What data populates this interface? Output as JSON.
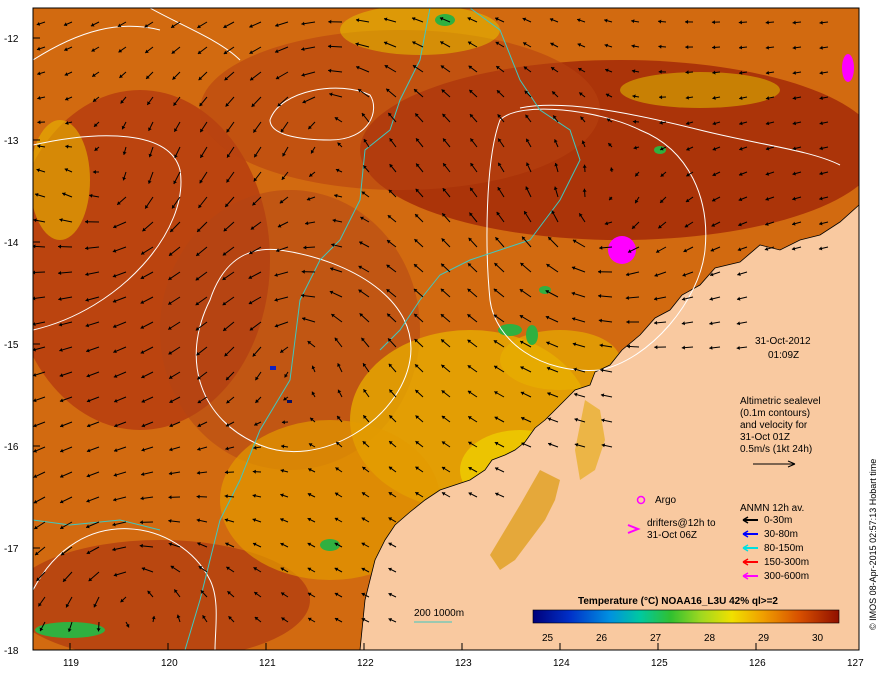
{
  "map": {
    "lon_ticks": [
      "119",
      "120",
      "121",
      "122",
      "123",
      "124",
      "125",
      "126",
      "127"
    ],
    "lat_ticks": [
      "-12",
      "-13",
      "-14",
      "-15",
      "-16",
      "-17",
      "-18"
    ],
    "date_label": "31-Oct-2012",
    "time_label": "01:09Z",
    "altimetry_lines": [
      "Altimetric sealevel",
      "(0.1m contours)",
      "and velocity for",
      "31-Oct 01Z",
      "0.5m/s (1kt 24h)"
    ],
    "argo_label": "Argo",
    "drifters_lines": [
      "drifters@12h to",
      "31-Oct 06Z"
    ],
    "anmn_title": "ANMN 12h av.",
    "anmn_legend": [
      {
        "label": "0-30m",
        "color": "#000000"
      },
      {
        "label": "30-80m",
        "color": "#0000ff"
      },
      {
        "label": "80-150m",
        "color": "#00e0e0"
      },
      {
        "label": "150-300m",
        "color": "#ff0000"
      },
      {
        "label": "300-600m",
        "color": "#ff00ff"
      }
    ],
    "depth_contour_label": "200  1000m",
    "colorbar_title": "Temperature (°C) NOAA16_L3U 42% ql>=2",
    "colorbar_ticks": [
      "25",
      "26",
      "27",
      "28",
      "29",
      "30"
    ],
    "credit": "© IMOS 08-Apr-2015 02:57:13 Hobart time",
    "colors": {
      "land": "#f9c9a0",
      "sst_hot": "#a01800",
      "sst_warm": "#d96a00",
      "sst_mid": "#e8a000",
      "sst_cool": "#f2e200",
      "green": "#3cb43c",
      "magenta": "#ff00ff",
      "contour_white": "#ffffff",
      "contour_cyan": "#40c8c0"
    }
  }
}
